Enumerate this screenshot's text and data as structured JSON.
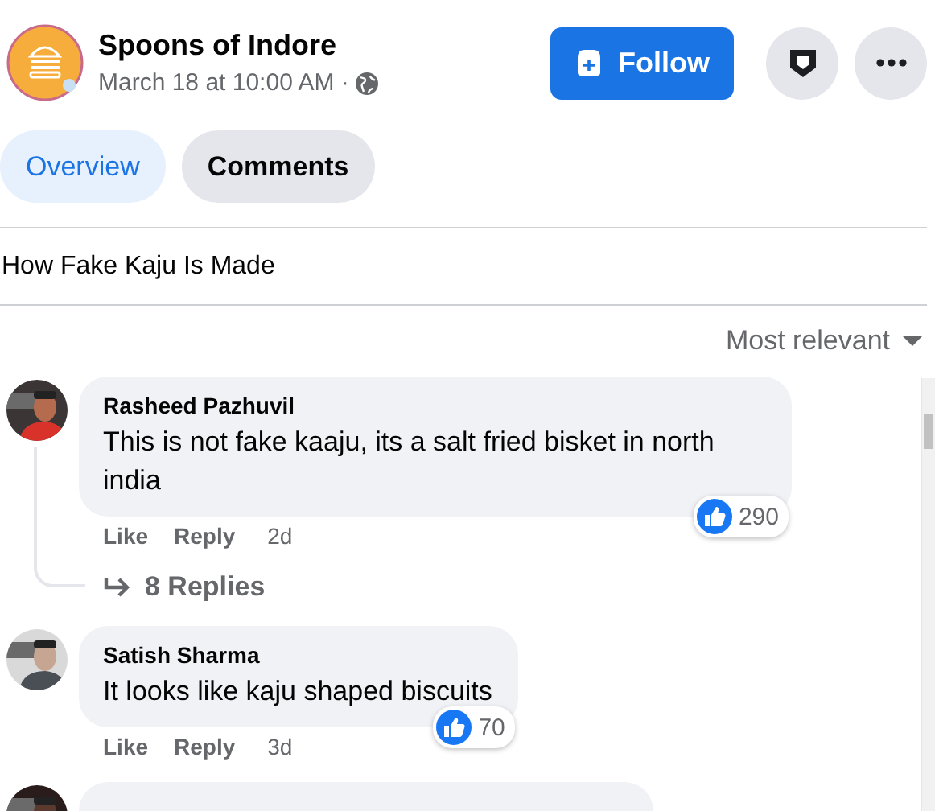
{
  "header": {
    "page_name": "Spoons of Indore",
    "timestamp": "March 18 at 10:00 AM ·",
    "follow_button": "Follow"
  },
  "tabs": [
    {
      "label": "Overview",
      "selected": true
    },
    {
      "label": "Comments",
      "selected": false
    }
  ],
  "post_title": "How Fake Kaju Is Made",
  "sort": {
    "label": "Most relevant"
  },
  "comments": [
    {
      "author": "Rasheed Pazhuvil",
      "text": "This is not fake kaaju, its a salt fried bisket in north india",
      "like_count": "290",
      "actions": [
        "Like",
        "Reply"
      ],
      "age": "2d",
      "replies_link": "8 Replies"
    },
    {
      "author": "Satish Sharma",
      "text": "It looks like kaju shaped biscuits",
      "like_count": "70",
      "actions": [
        "Like",
        "Reply"
      ],
      "age": "3d"
    }
  ]
}
